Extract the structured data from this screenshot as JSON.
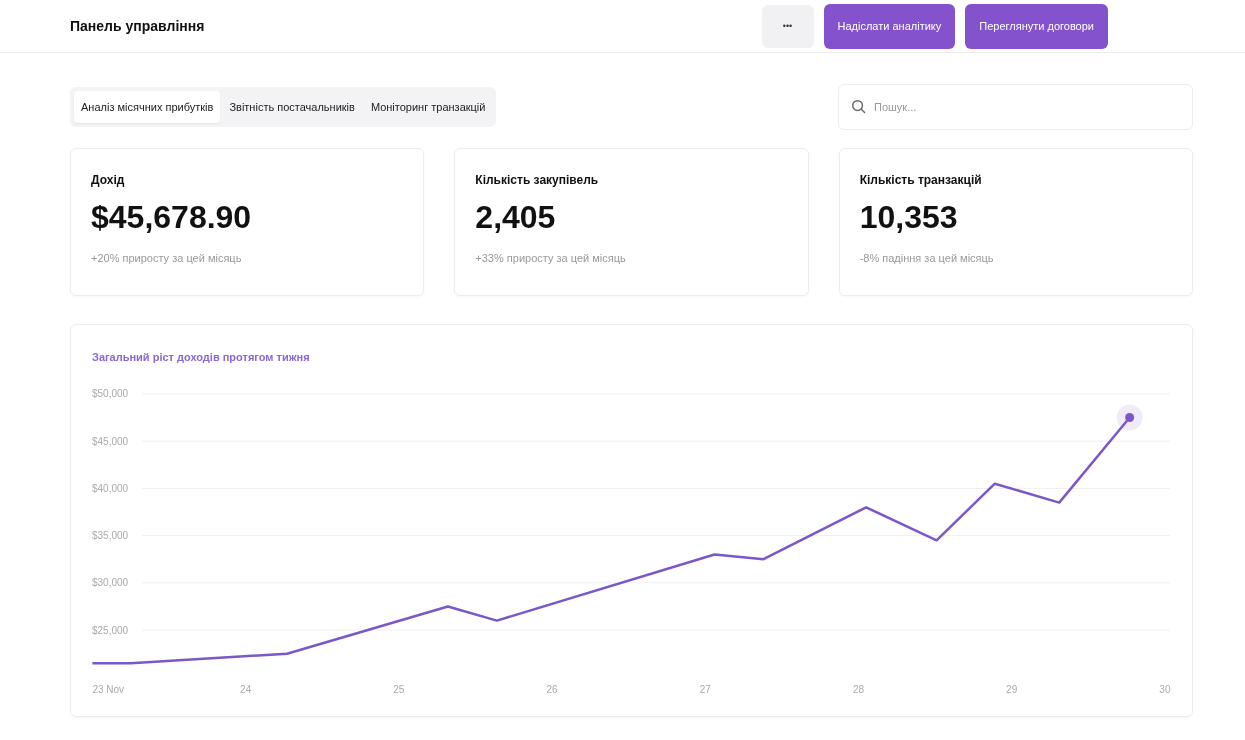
{
  "header": {
    "title": "Панель управління",
    "more_label": "•••",
    "buttons": [
      "Надіслати аналітику",
      "Переглянути договори"
    ]
  },
  "tabs": [
    {
      "label": "Аналіз місячних прибутків",
      "selected": true
    },
    {
      "label": "Звітність постачальників",
      "selected": false
    },
    {
      "label": "Моніторинг транзакцій",
      "selected": false
    }
  ],
  "search": {
    "placeholder": "Пошук..."
  },
  "cards": [
    {
      "title": "Дохід",
      "value": "$45,678.90",
      "note": "+20% приросту за цей місяць"
    },
    {
      "title": "Кількість закупівель",
      "value": "2,405",
      "note": "+33% приросту за цей місяць"
    },
    {
      "title": "Кількість транзакцій",
      "value": "10,353",
      "note": "-8% падіння за цей місяць"
    }
  ],
  "chart": {
    "chart_data": {
      "type": "line",
      "title": "Загальний ріст доходів протягом тижня",
      "x": [
        23,
        23.25,
        24.27,
        25.32,
        25.64,
        27.06,
        27.38,
        28.05,
        28.51,
        28.89,
        29.31,
        29.77
      ],
      "series": [
        {
          "color": "#7b57c9",
          "values": [
            21500,
            21500,
            22500,
            27500,
            26000,
            33000,
            32500,
            38000,
            34500,
            40500,
            38500,
            47500
          ]
        }
      ],
      "xlim": [
        22.86,
        30.19
      ],
      "ylim": [
        15800,
        57400
      ],
      "grid": true,
      "xticks": [
        {
          "value": 23,
          "label": "23 Nov"
        },
        24,
        25,
        26,
        27,
        28,
        29,
        30
      ],
      "yticks": [
        {
          "value": 25000,
          "label": "$25,000"
        },
        {
          "value": 30000,
          "label": "$30,000"
        },
        {
          "value": 35000,
          "label": "$35,000"
        },
        {
          "value": 40000,
          "label": "$40,000"
        },
        {
          "value": 45000,
          "label": "$45,000"
        },
        {
          "value": 50000,
          "label": "$50,000"
        }
      ]
    }
  }
}
